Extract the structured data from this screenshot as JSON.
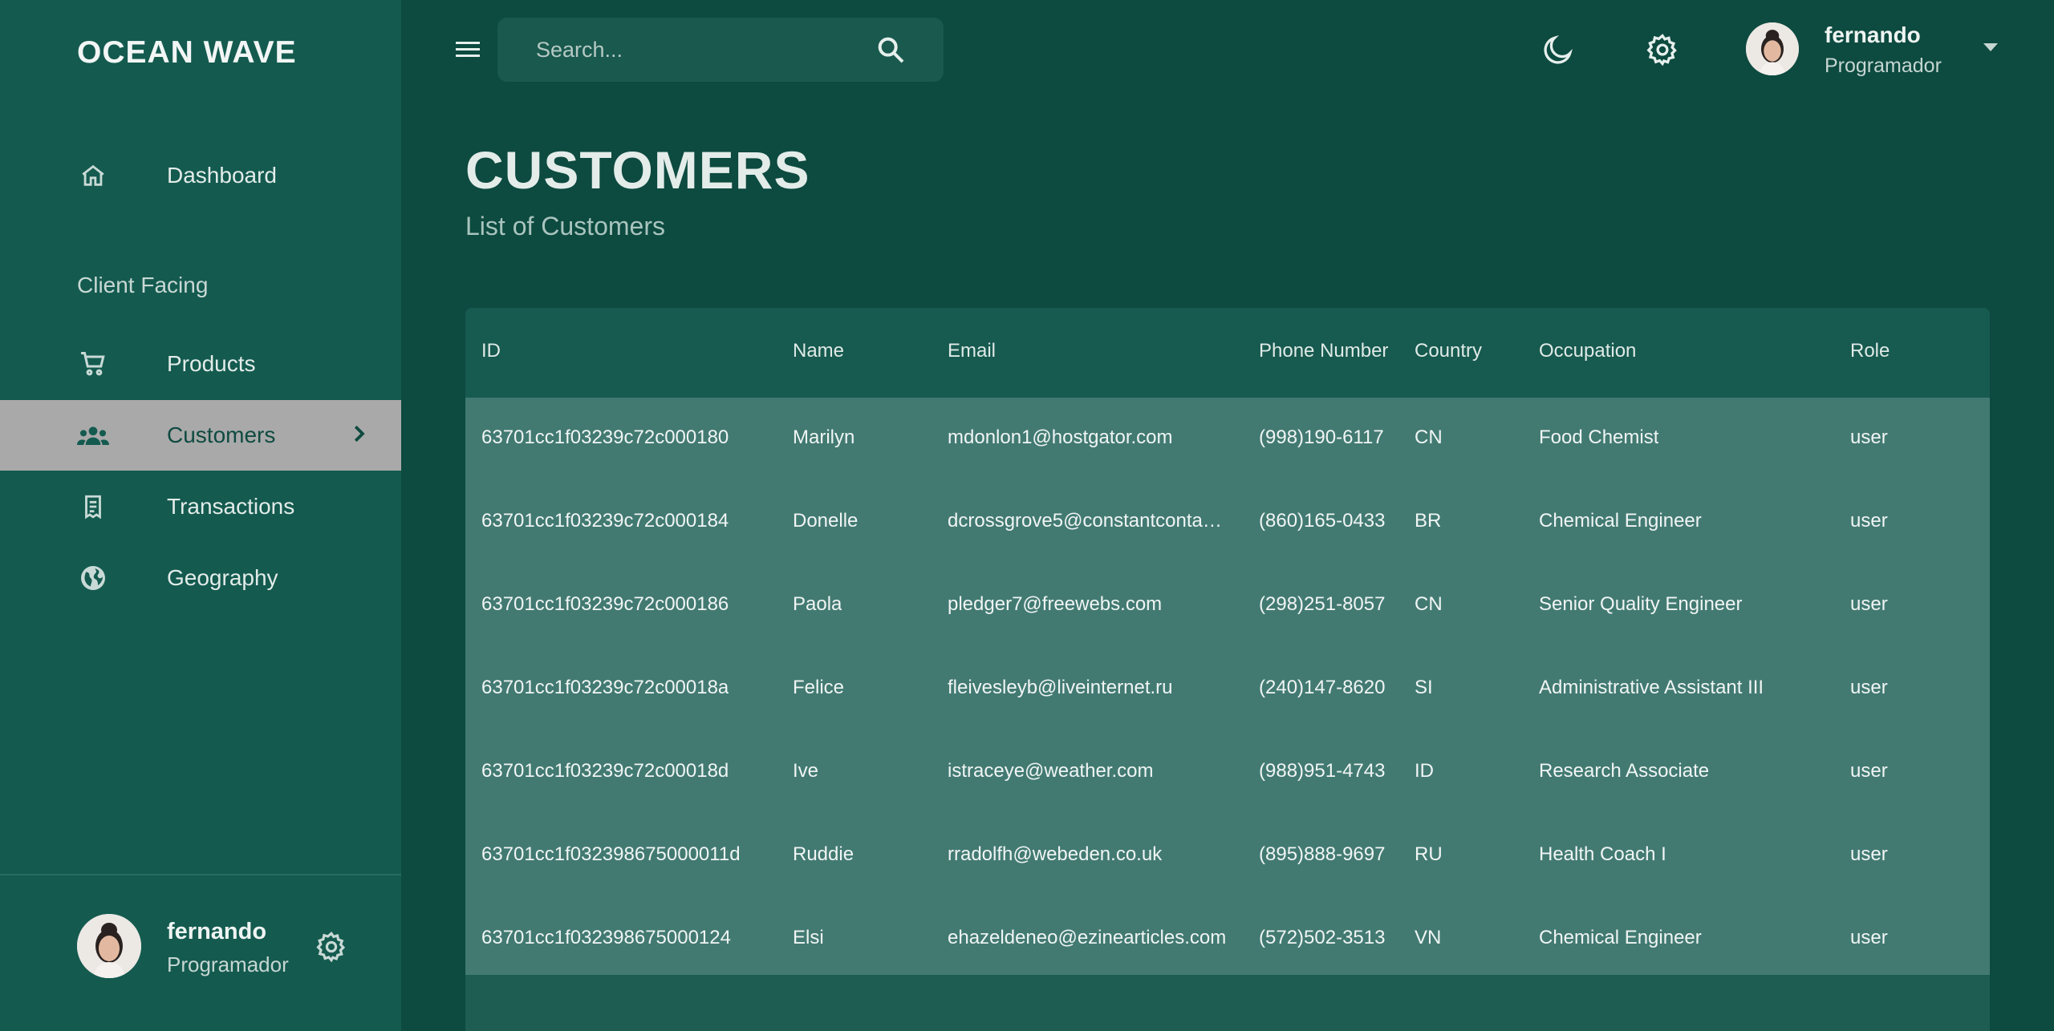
{
  "app": {
    "brand": "OCEAN WAVE"
  },
  "sidebar": {
    "items": [
      {
        "label": "Dashboard",
        "icon": "home-icon"
      },
      {
        "label": "Products",
        "icon": "cart-icon"
      },
      {
        "label": "Customers",
        "icon": "group-icon",
        "active": true
      },
      {
        "label": "Transactions",
        "icon": "receipt-icon"
      },
      {
        "label": "Geography",
        "icon": "globe-icon"
      }
    ],
    "section_label": "Client Facing",
    "user": {
      "name": "fernando",
      "role": "Programador"
    }
  },
  "topbar": {
    "search_placeholder": "Search...",
    "user": {
      "name": "fernando",
      "role": "Programador"
    }
  },
  "page": {
    "title": "CUSTOMERS",
    "subtitle": "List of Customers"
  },
  "table": {
    "columns": [
      "ID",
      "Name",
      "Email",
      "Phone Number",
      "Country",
      "Occupation",
      "Role"
    ],
    "rows": [
      [
        "63701cc1f03239c72c000180",
        "Marilyn",
        "mdonlon1@hostgator.com",
        "(998)190-6117",
        "CN",
        "Food Chemist",
        "user"
      ],
      [
        "63701cc1f03239c72c000184",
        "Donelle",
        "dcrossgrove5@constantconta…",
        "(860)165-0433",
        "BR",
        "Chemical Engineer",
        "user"
      ],
      [
        "63701cc1f03239c72c000186",
        "Paola",
        "pledger7@freewebs.com",
        "(298)251-8057",
        "CN",
        "Senior Quality Engineer",
        "user"
      ],
      [
        "63701cc1f03239c72c00018a",
        "Felice",
        "fleivesleyb@liveinternet.ru",
        "(240)147-8620",
        "SI",
        "Administrative Assistant III",
        "user"
      ],
      [
        "63701cc1f03239c72c00018d",
        "Ive",
        "istraceye@weather.com",
        "(988)951-4743",
        "ID",
        "Research Associate",
        "user"
      ],
      [
        "63701cc1f032398675000011d",
        "Ruddie",
        "rradolfh@webeden.co.uk",
        "(895)888-9697",
        "RU",
        "Health Coach I",
        "user"
      ],
      [
        "63701cc1f032398675000124",
        "Elsi",
        "ehazeldeneo@ezinearticles.com",
        "(572)502-3513",
        "VN",
        "Chemical Engineer",
        "user"
      ]
    ]
  },
  "colors": {
    "background": "#0d4a40",
    "sidebar": "#145a4f",
    "active_item": "#a9a9a9",
    "table_body": "#427a72"
  }
}
